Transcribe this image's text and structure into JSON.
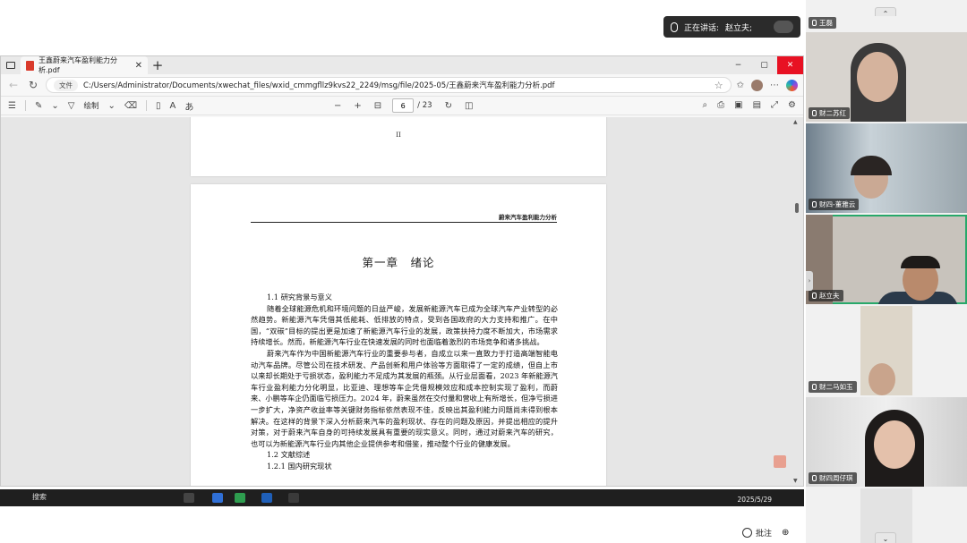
{
  "meeting": {
    "speaking_label": "正在讲话:",
    "speaker_name": "赵立夫;",
    "annotate_label": "批注",
    "zoom_symbol": "⊕"
  },
  "participants": [
    {
      "name": "王磊"
    },
    {
      "name": "财二苏红"
    },
    {
      "name": "财四-董雅云"
    },
    {
      "name": "赵立夫",
      "active": true
    },
    {
      "name": "财二马如玉"
    },
    {
      "name": "财四周仔琪"
    }
  ],
  "browser": {
    "tab_title": "王鑫蔚来汽车盈利能力分析.pdf",
    "address_chip": "文件",
    "url": "C:/Users/Administrator/Documents/xwechat_files/wxid_cmmgfllz9kvs22_2249/msg/file/2025-05/王鑫蔚来汽车盈利能力分析.pdf",
    "window_min": "−",
    "window_max": "▢",
    "window_close": "✕"
  },
  "pdf_toolbar": {
    "draw_label": "绘制",
    "page_current": "6",
    "page_total": "/ 23"
  },
  "document": {
    "prev_page_number": "II",
    "running_header": "蔚来汽车盈利能力分析",
    "chapter_title": "第一章　绪论",
    "h_1_1": "1.1 研究背景与意义",
    "p1": "随着全球能源危机和环境问题的日益严峻，发展新能源汽车已成为全球汽车产业转型的必然趋势。新能源汽车凭借其低能耗、低排放的特点，受到各国政府的大力支持和推广。在中国，“双碳”目标的提出更是加速了新能源汽车行业的发展，政策扶持力度不断加大，市场需求持续增长。然而，新能源汽车行业在快速发展的同时也面临着激烈的市场竞争和诸多挑战。",
    "p2": "蔚来汽车作为中国新能源汽车行业的重要参与者，自成立以来一直致力于打造高端智能电动汽车品牌。尽管公司在技术研发、产品创新和用户体验等方面取得了一定的成绩，但自上市以来却长期处于亏损状态，盈利能力不足成为其发展的瓶颈。从行业层面看，2023 年新能源汽车行业盈利能力分化明显，比亚迪、理想等车企凭借规模效应和成本控制实现了盈利，而蔚来、小鹏等车企仍面临亏损压力。2024 年，蔚来虽然在交付量和营收上有所增长，但净亏损进一步扩大，净资产收益率等关键财务指标依然表现不佳，反映出其盈利能力问题尚未得到根本解决。在这样的背景下深入分析蔚来汽车的盈利现状、存在的问题及原因，并提出相应的提升对策，对于蔚来汽车自身的可持续发展具有重要的现实意义。同时，通过对蔚来汽车的研究，也可以为新能源汽车行业内其他企业提供参考和借鉴，推动整个行业的健康发展。",
    "h_1_2": "1.2 文献综述",
    "h_1_2_1": "1.2.1 国内研究现状"
  },
  "taskbar": {
    "search_label": "搜索",
    "date": "2025/5/29"
  }
}
